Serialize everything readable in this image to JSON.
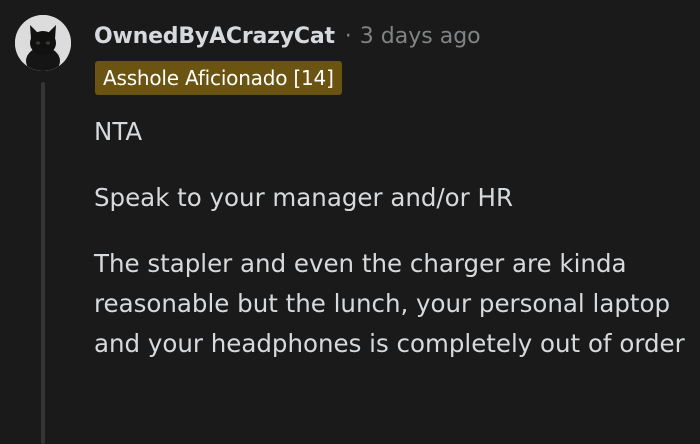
{
  "comment": {
    "author": "OwnedByACrazyCat",
    "separator": "·",
    "timestamp": "3 days ago",
    "flair": "Asshole Aficionado [14]",
    "paragraphs": [
      "NTA",
      "Speak to your manager and/or HR",
      "The stapler and even the charger are kinda reasonable but the lunch, your personal laptop and your headphones is completely out of order"
    ]
  },
  "icons": {
    "avatar": "black-cat-avatar-icon"
  },
  "colors": {
    "background": "#1a1a1b",
    "text": "#d7dadc",
    "muted": "#818384",
    "flair_background": "#6b5411",
    "thread_line": "#343536"
  }
}
